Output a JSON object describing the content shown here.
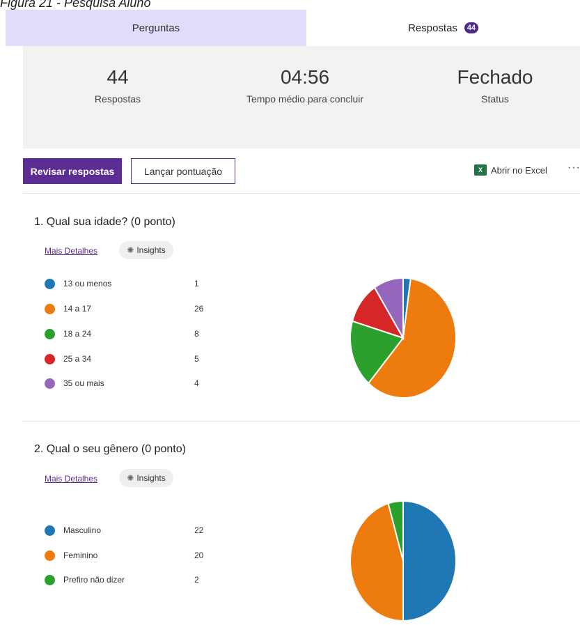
{
  "caption": "Figura 21 - Pesquisa Aluno",
  "tabs": {
    "questions": "Perguntas",
    "responses": "Respostas",
    "responses_badge": "44"
  },
  "stats": [
    {
      "value": "44",
      "label": "Respostas"
    },
    {
      "value": "04:56",
      "label": "Tempo médio para concluir"
    },
    {
      "value": "Fechado",
      "label": "Status"
    }
  ],
  "toolbar": {
    "review_label": "Revisar respostas",
    "score_label": "Lançar pontuação",
    "excel_icon": "excel-icon",
    "excel_label": "Abrir no Excel",
    "more_label": "···"
  },
  "questions": [
    {
      "title": "1. Qual sua idade? (0 ponto)",
      "details_link": "Mais Detalhes",
      "insights_label": "Insights",
      "options": [
        {
          "label": "13 ou menos",
          "count": "1"
        },
        {
          "label": "14 a 17",
          "count": "26"
        },
        {
          "label": "18 a 24",
          "count": "8"
        },
        {
          "label": "25 a 34",
          "count": "5"
        },
        {
          "label": "35 ou mais",
          "count": "4"
        }
      ]
    },
    {
      "title": "2. Qual o seu gênero (0 ponto)",
      "details_link": "Mais Detalhes",
      "insights_label": "Insights",
      "options": [
        {
          "label": "Masculino",
          "count": "22"
        },
        {
          "label": "Feminino",
          "count": "20"
        },
        {
          "label": "Prefiro não dizer",
          "count": "2"
        }
      ]
    }
  ],
  "colors": {
    "accent": "#5b2c91",
    "tab_active_bg": "#e2dcfa",
    "series": [
      "#1f77b4",
      "#ee7b0d",
      "#2ca02c",
      "#d62728",
      "#9467bd"
    ]
  },
  "chart_data": [
    {
      "type": "pie",
      "categories": [
        "13 ou menos",
        "14 a 17",
        "18 a 24",
        "25 a 34",
        "35 ou mais"
      ],
      "values": [
        1,
        26,
        8,
        5,
        4
      ]
    },
    {
      "type": "pie",
      "categories": [
        "Masculino",
        "Feminino",
        "Prefiro não dizer"
      ],
      "values": [
        22,
        20,
        2
      ]
    }
  ]
}
